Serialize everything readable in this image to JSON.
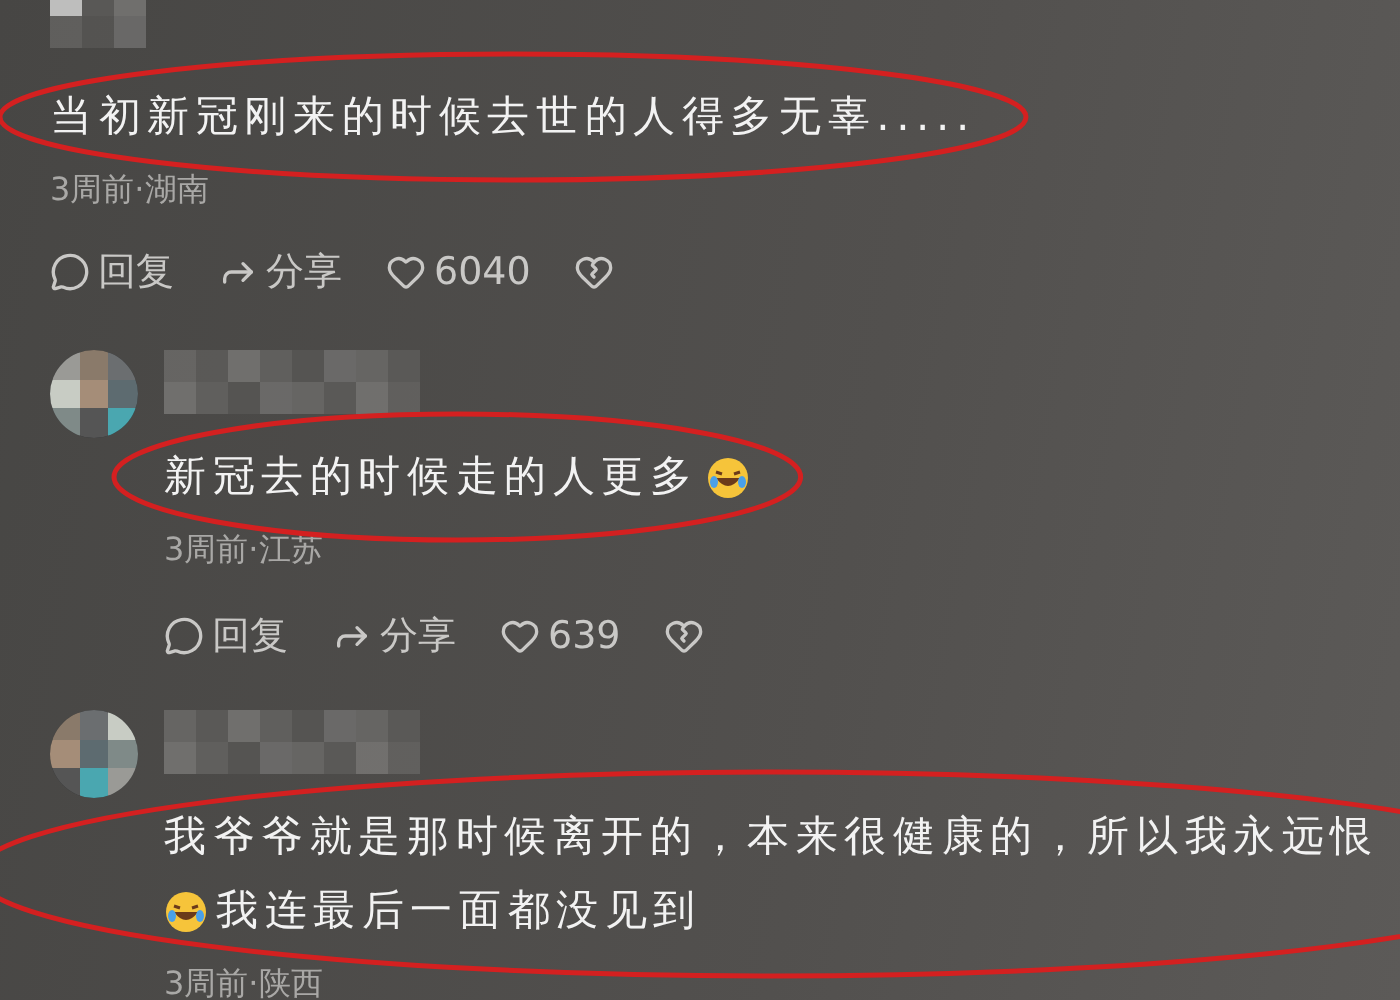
{
  "comments": [
    {
      "nested": false,
      "highlighted": true,
      "lines": [
        [
          {
            "kind": "text",
            "text": "当初新冠刚来的时候去世的人得多无辜....."
          }
        ]
      ],
      "meta": "3周前·湖南",
      "actions": {
        "reply": "回复",
        "share": "分享",
        "likes": "6040"
      }
    },
    {
      "nested": true,
      "highlighted": true,
      "lines": [
        [
          {
            "kind": "text",
            "text": "新冠去的时候走的人更多"
          },
          {
            "kind": "emoji"
          }
        ]
      ],
      "meta": "3周前·江苏",
      "actions": {
        "reply": "回复",
        "share": "分享",
        "likes": "639"
      }
    },
    {
      "nested": true,
      "highlighted": true,
      "lines": [
        [
          {
            "kind": "text",
            "text": "我爷爷就是那时候离开的，本来很健康的，所以我永远恨"
          }
        ],
        [
          {
            "kind": "emoji"
          },
          {
            "kind": "text",
            "text": "我连最后一面都没见到"
          }
        ]
      ],
      "meta": "3周前·陕西"
    }
  ]
}
